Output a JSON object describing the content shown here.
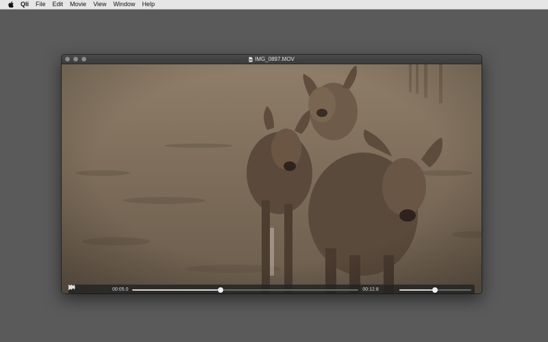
{
  "menubar": {
    "app_name": "Qli",
    "items": [
      "File",
      "Edit",
      "Movie",
      "View",
      "Window",
      "Help"
    ]
  },
  "window": {
    "title": "IMG_0897.MOV"
  },
  "player": {
    "current_time": "00:05.0",
    "remaining_time": "00:12.8",
    "progress": 0.39,
    "volume": 0.5
  },
  "icons": {
    "apple": "apple-icon",
    "file": "movie-file-icon",
    "rewind": "rewind-icon",
    "play": "play-icon",
    "fast_forward": "fast-forward-icon",
    "speaker": "speaker-icon"
  }
}
